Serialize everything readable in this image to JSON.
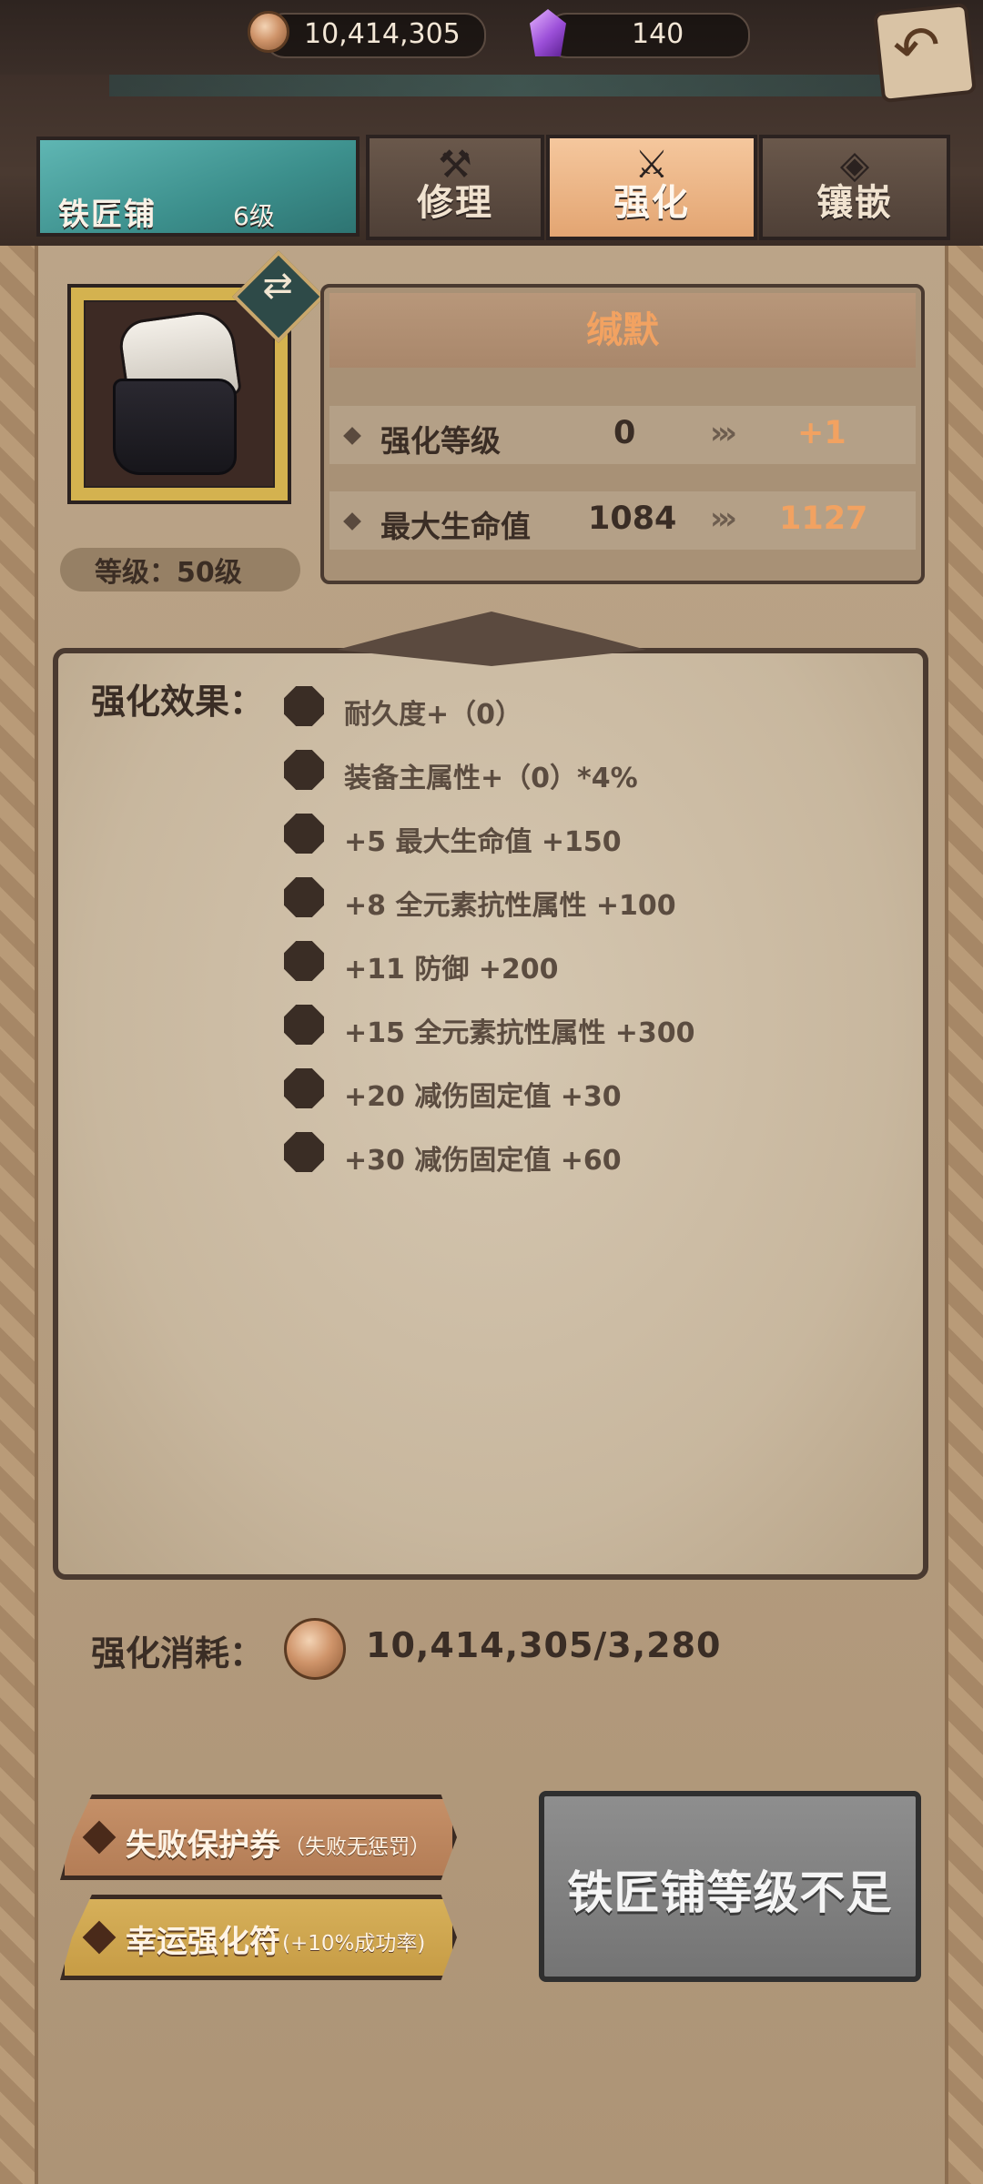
{
  "resources": {
    "gold": "10,414,305",
    "gems": "140"
  },
  "header": {
    "shop_name": "铁匠铺",
    "shop_level": "6级",
    "tabs": [
      {
        "label": "修理"
      },
      {
        "label": "强化"
      },
      {
        "label": "镶嵌"
      }
    ],
    "active_tab": "强化"
  },
  "item": {
    "name": "缄默",
    "level_label": "等级：50级",
    "stats": [
      {
        "label": "强化等级",
        "current": "0",
        "next": "+1"
      },
      {
        "label": "最大生命值",
        "current": "1084",
        "next": "1127"
      }
    ]
  },
  "effects": {
    "title": "强化效果：",
    "items": [
      "耐久度+（0）",
      "装备主属性+（0）*4%",
      "+5  最大生命值 +150",
      "+8  全元素抗性属性 +100",
      "+11  防御 +200",
      "+15  全元素抗性属性 +300",
      "+20  减伤固定值 +30",
      "+30  减伤固定值 +60"
    ]
  },
  "cost": {
    "label": "强化消耗：",
    "value": "10,414,305/3,280"
  },
  "buffs": [
    {
      "label": "失败保护券",
      "sub": "（失败无惩罚）"
    },
    {
      "label": "幸运强化符",
      "sub": "(+10%成功率)"
    }
  ],
  "main_button": {
    "label": "铁匠铺等级不足"
  },
  "colors": {
    "accent_orange": "#f2a261",
    "dark_text": "#3a2d25",
    "disabled_button": "#7f7f7f"
  },
  "icons": [
    "gold-coin-icon",
    "gem-icon",
    "back-arrow-icon",
    "hammer-icon",
    "sword-wings-icon",
    "gem-socket-icon",
    "swap-icon"
  ]
}
